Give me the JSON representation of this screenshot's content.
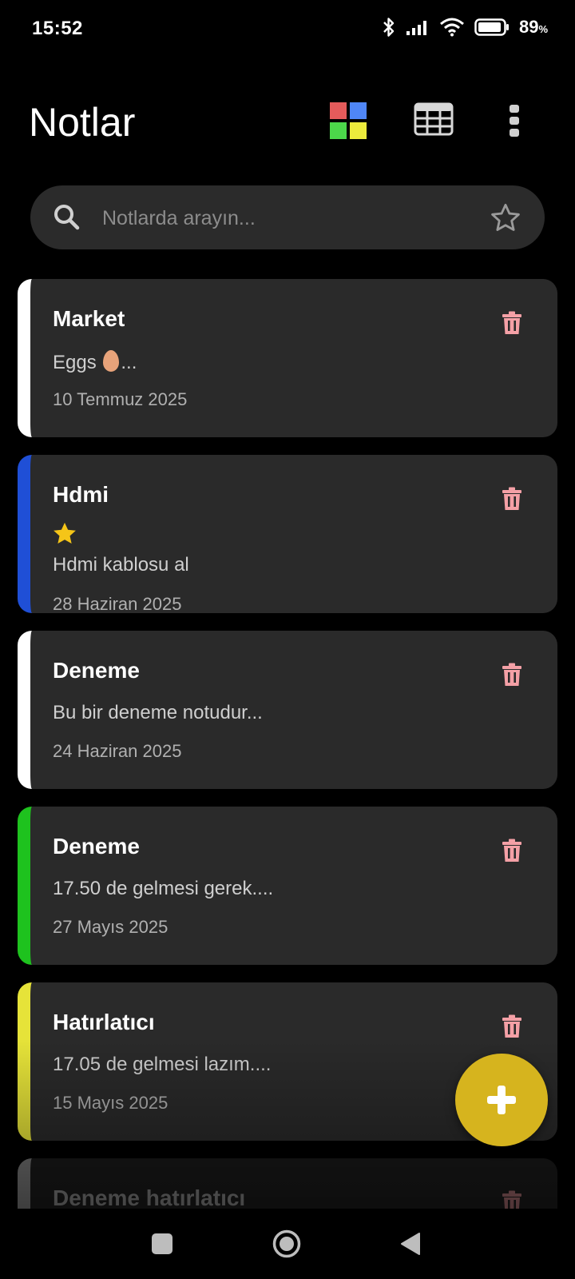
{
  "status_bar": {
    "time": "15:52",
    "battery": "89",
    "battery_unit": "%"
  },
  "app": {
    "title": "Notlar"
  },
  "toolbar": {
    "color_grid_icon": "color-grid-icon",
    "table_view_icon": "table-grid-icon",
    "more_icon": "more-vertical-icon",
    "color_grid_colors": [
      "#e45b5b",
      "#4f86f7",
      "#4cd84a",
      "#eceb3c"
    ]
  },
  "search": {
    "placeholder": "Notlarda arayın...",
    "value": ""
  },
  "notes": [
    {
      "title": "Market",
      "line1": "Eggs",
      "line1_suffix": "...",
      "line1_icon": "egg-emoji",
      "date": "10 Temmuz 2025",
      "color": "#ffffff"
    },
    {
      "title": "Hdmi",
      "starred": true,
      "line1": "Hdmi kablosu al",
      "date": "28 Haziran 2025",
      "color": "#1f4fd6"
    },
    {
      "title": "Deneme",
      "line1": "Bu bir deneme notudur...",
      "date": "24 Haziran 2025",
      "color": "#ffffff"
    },
    {
      "title": "Deneme",
      "line1": "17.50 de gelmesi gerek....",
      "date": "27 Mayıs 2025",
      "color": "#1ec21e"
    },
    {
      "title": "Hatırlatıcı",
      "line1": "17.05 de gelmesi lazım....",
      "date": "15 Mayıs 2025",
      "color": "#e6e339"
    },
    {
      "title": "Deneme hatırlatıcı",
      "date": "",
      "color": "#bdbdbd"
    }
  ],
  "colors": {
    "background": "#000000",
    "card": "#2a2a2a",
    "trash": "#f4a0a6",
    "fab": "#d6b41e",
    "star": "#f5c518"
  },
  "fab": {
    "icon": "plus-icon"
  },
  "nav": {
    "recent_icon": "square-icon",
    "home_icon": "circle-home-icon",
    "back_icon": "triangle-back-icon"
  }
}
